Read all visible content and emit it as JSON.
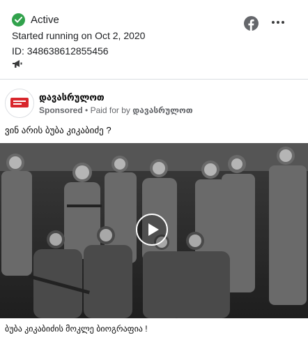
{
  "status": {
    "label": "Active",
    "started": "Started running on Oct 2, 2020",
    "id_text": "ID: 348638612855456"
  },
  "icons": {
    "status": "check-circle-icon",
    "platform": "facebook-icon",
    "platform_channel": "megaphone-icon",
    "menu": "more-options-icon",
    "media_control": "play-icon"
  },
  "ad": {
    "page_name": "დავასრულოთ",
    "sponsored_label": "Sponsored",
    "separator": "•",
    "paid_for_prefix": "Paid for by",
    "paid_for_name": "დავასრულოთ",
    "body_text": "ვინ არის ბუბა კიკაბიძე ?",
    "caption": "ბუბა კიკაბიძის მოკლე ბიოგრაფია !"
  },
  "colors": {
    "active_green": "#31a24c",
    "secondary_text": "#65676b",
    "avatar_red": "#d8262c"
  }
}
